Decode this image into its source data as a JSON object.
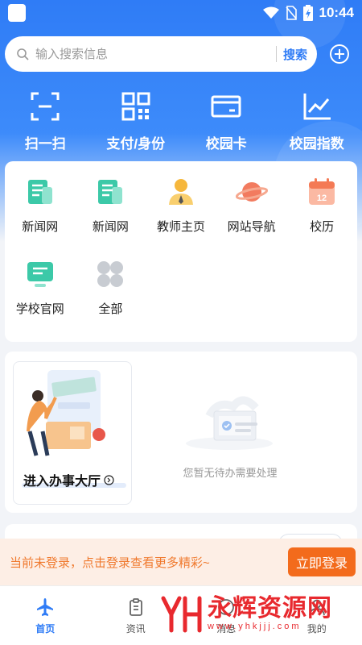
{
  "status_bar": {
    "time": "10:44",
    "icons": [
      "wifi-icon",
      "no-sim-icon",
      "battery-charging-icon"
    ]
  },
  "search": {
    "placeholder": "输入搜索信息",
    "button_label": "搜索",
    "add_icon": "plus-circle-icon"
  },
  "quick_actions": [
    {
      "label": "扫一扫",
      "icon": "scan-icon"
    },
    {
      "label": "支付/身份",
      "icon": "qr-code-icon"
    },
    {
      "label": "校园卡",
      "icon": "card-icon"
    },
    {
      "label": "校园指数",
      "icon": "trend-chart-icon"
    }
  ],
  "apps": [
    {
      "label": "新闻网",
      "icon": "news-icon"
    },
    {
      "label": "新闻网",
      "icon": "news-icon"
    },
    {
      "label": "教师主页",
      "icon": "teacher-icon"
    },
    {
      "label": "网站导航",
      "icon": "planet-icon"
    },
    {
      "label": "校历",
      "icon": "calendar-icon",
      "badge": "12"
    },
    {
      "label": "学校官网",
      "icon": "monitor-icon"
    },
    {
      "label": "全部",
      "icon": "all-apps-icon"
    }
  ],
  "todo": {
    "hall_label": "进入办事大厅",
    "empty_text": "您暂无待办需要处理"
  },
  "login_banner": {
    "text": "当前未登录，点击登录查看更多精彩~",
    "button_label": "立即登录"
  },
  "tabs": [
    {
      "label": "首页",
      "icon": "airplane-icon",
      "active": true
    },
    {
      "label": "资讯",
      "icon": "clipboard-icon",
      "active": false
    },
    {
      "label": "消息",
      "icon": "message-icon",
      "active": false
    },
    {
      "label": "我的",
      "icon": "user-icon",
      "active": false
    }
  ],
  "watermark": {
    "logo_text": "YH",
    "main": "永辉资源网",
    "sub": "www.yhkjjj.com"
  },
  "colors": {
    "primary": "#2f7cf6",
    "login_orange": "#f36b1c",
    "banner_bg": "#fdeee5"
  }
}
